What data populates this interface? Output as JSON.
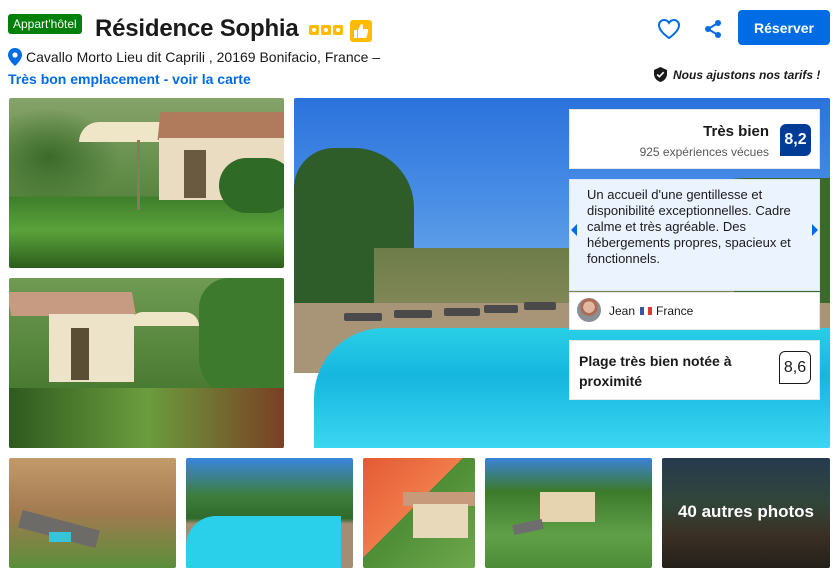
{
  "header": {
    "type_badge": "Appart'hôtel",
    "hotel_name": "Résidence Sophia",
    "star_count": 3,
    "address": "Cavallo Morto Lieu dit Caprili , 20169 Bonifacio, France –",
    "map_link": "Très bon emplacement - voir la carte",
    "reserve_label": "Réserver",
    "price_note": "Nous ajustons nos tarifs !"
  },
  "icons": {
    "type_badge_color": "#008009",
    "star_color": "#febb02",
    "thumb": "thumbs-up-icon",
    "pin": "map-pin-icon",
    "favorite": "heart-icon",
    "share": "share-icon",
    "price_shield": "shield-check-icon",
    "accent": "#006ce4",
    "score_badge_color": "#003b95"
  },
  "review": {
    "label": "Très bien",
    "count": "925 expériences vécues",
    "score": "8,2",
    "quote": "Un accueil d'une gentillesse et disponibilité exceptionnelles. Cadre calme et très agréable. Des hébergements propres, spacieux et fonctionnels.",
    "reviewer": "Jean",
    "country": "France",
    "nearby_label": "Plage très bien notée à proximité",
    "nearby_score": "8,6"
  },
  "gallery": {
    "more_photos": "40 autres photos"
  }
}
